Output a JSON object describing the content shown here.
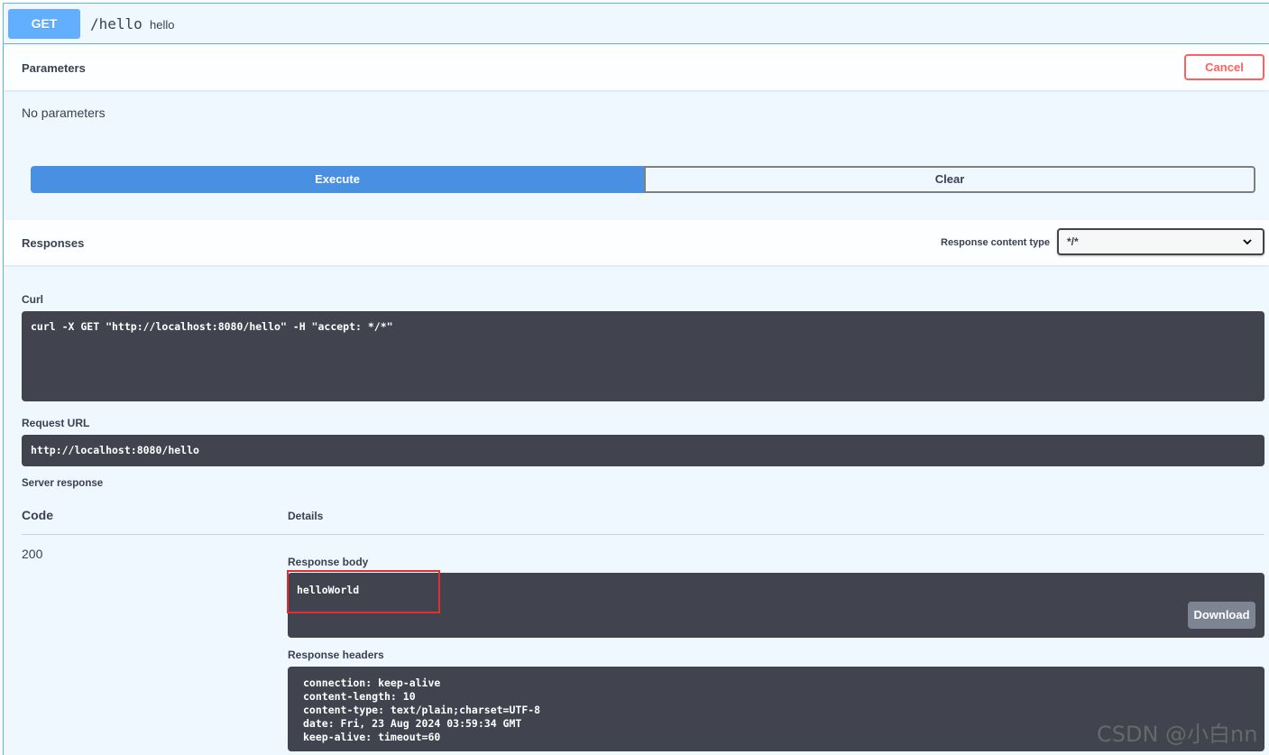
{
  "operation": {
    "method": "GET",
    "path": "/hello",
    "summary": "hello"
  },
  "parameters": {
    "title": "Parameters",
    "cancel_label": "Cancel",
    "empty_text": "No parameters"
  },
  "actions": {
    "execute_label": "Execute",
    "clear_label": "Clear"
  },
  "responses": {
    "title": "Responses",
    "content_type_label": "Response content type",
    "content_type_value": "*/*"
  },
  "curl": {
    "label": "Curl",
    "command": "curl -X GET \"http://localhost:8080/hello\" -H \"accept: */*\""
  },
  "request_url": {
    "label": "Request URL",
    "value": "http://localhost:8080/hello"
  },
  "server_response": {
    "label": "Server response",
    "code_header": "Code",
    "details_header": "Details",
    "code": "200",
    "body_label": "Response body",
    "body": "helloWorld",
    "download_label": "Download",
    "headers_label": "Response headers",
    "headers": [
      "connection: keep-alive",
      "content-length: 10",
      "content-type: text/plain;charset=UTF-8",
      "date: Fri, 23 Aug 2024 03:59:34 GMT",
      "keep-alive: timeout=60"
    ]
  },
  "watermark": "CSDN @小白nn"
}
